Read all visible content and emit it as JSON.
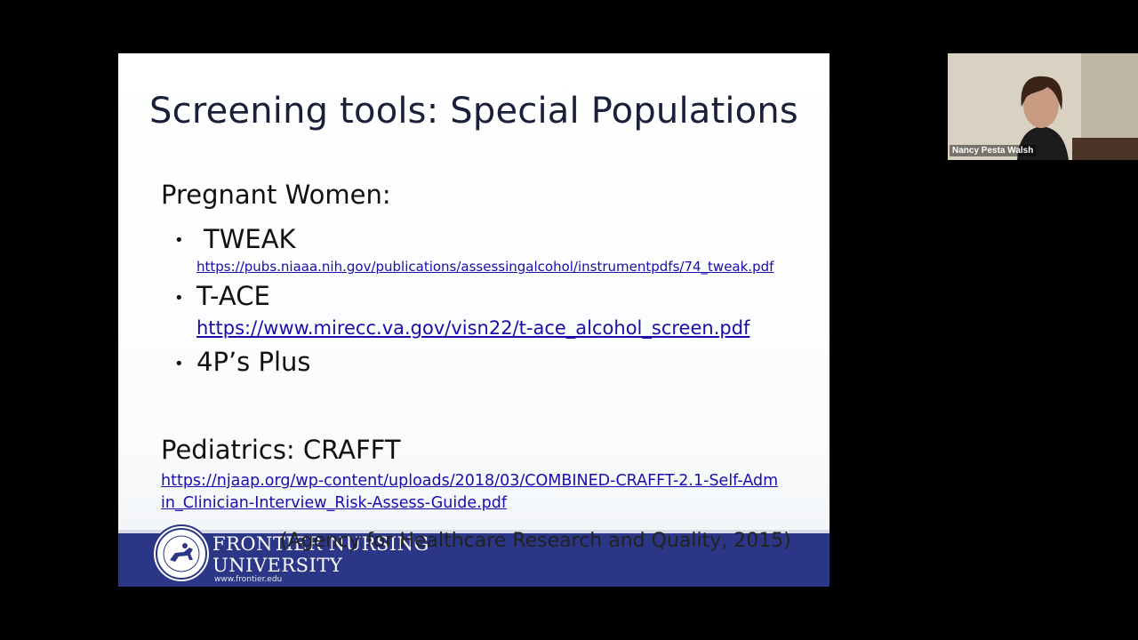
{
  "slide": {
    "title": "Screening tools: Special Populations",
    "pregnant_heading": "Pregnant Women:",
    "bullets": [
      {
        "label": "TWEAK",
        "link": "https://pubs.niaaa.nih.gov/publications/assessingalcohol/instrumentpdfs/74_tweak.pdf"
      },
      {
        "label": "T-ACE",
        "link": "https://www.mirecc.va.gov/visn22/t-ace_alcohol_screen.pdf"
      },
      {
        "label": "4P’s Plus",
        "link": ""
      }
    ],
    "pediatrics_heading": "Pediatrics:  CRAFFT",
    "pediatrics_link_line1": "https://njaap.org/wp-content/uploads/2018/03/COMBINED-CRAFFT-2.1-Self-Adm",
    "pediatrics_link_line2": "in_Clinician-Interview_Risk-Assess-Guide.pdf",
    "citation": "(Agency for Healthcare Research and Quality, 2015)",
    "bullet_glyph": "•"
  },
  "footer": {
    "brand_line1": "FRONTIER NURSING",
    "brand_line2": "UNIVERSITY",
    "url": "www.frontier.edu",
    "bar_color": "#2b3686"
  },
  "video": {
    "participant_name": "Nancy Pesta Walsh"
  }
}
